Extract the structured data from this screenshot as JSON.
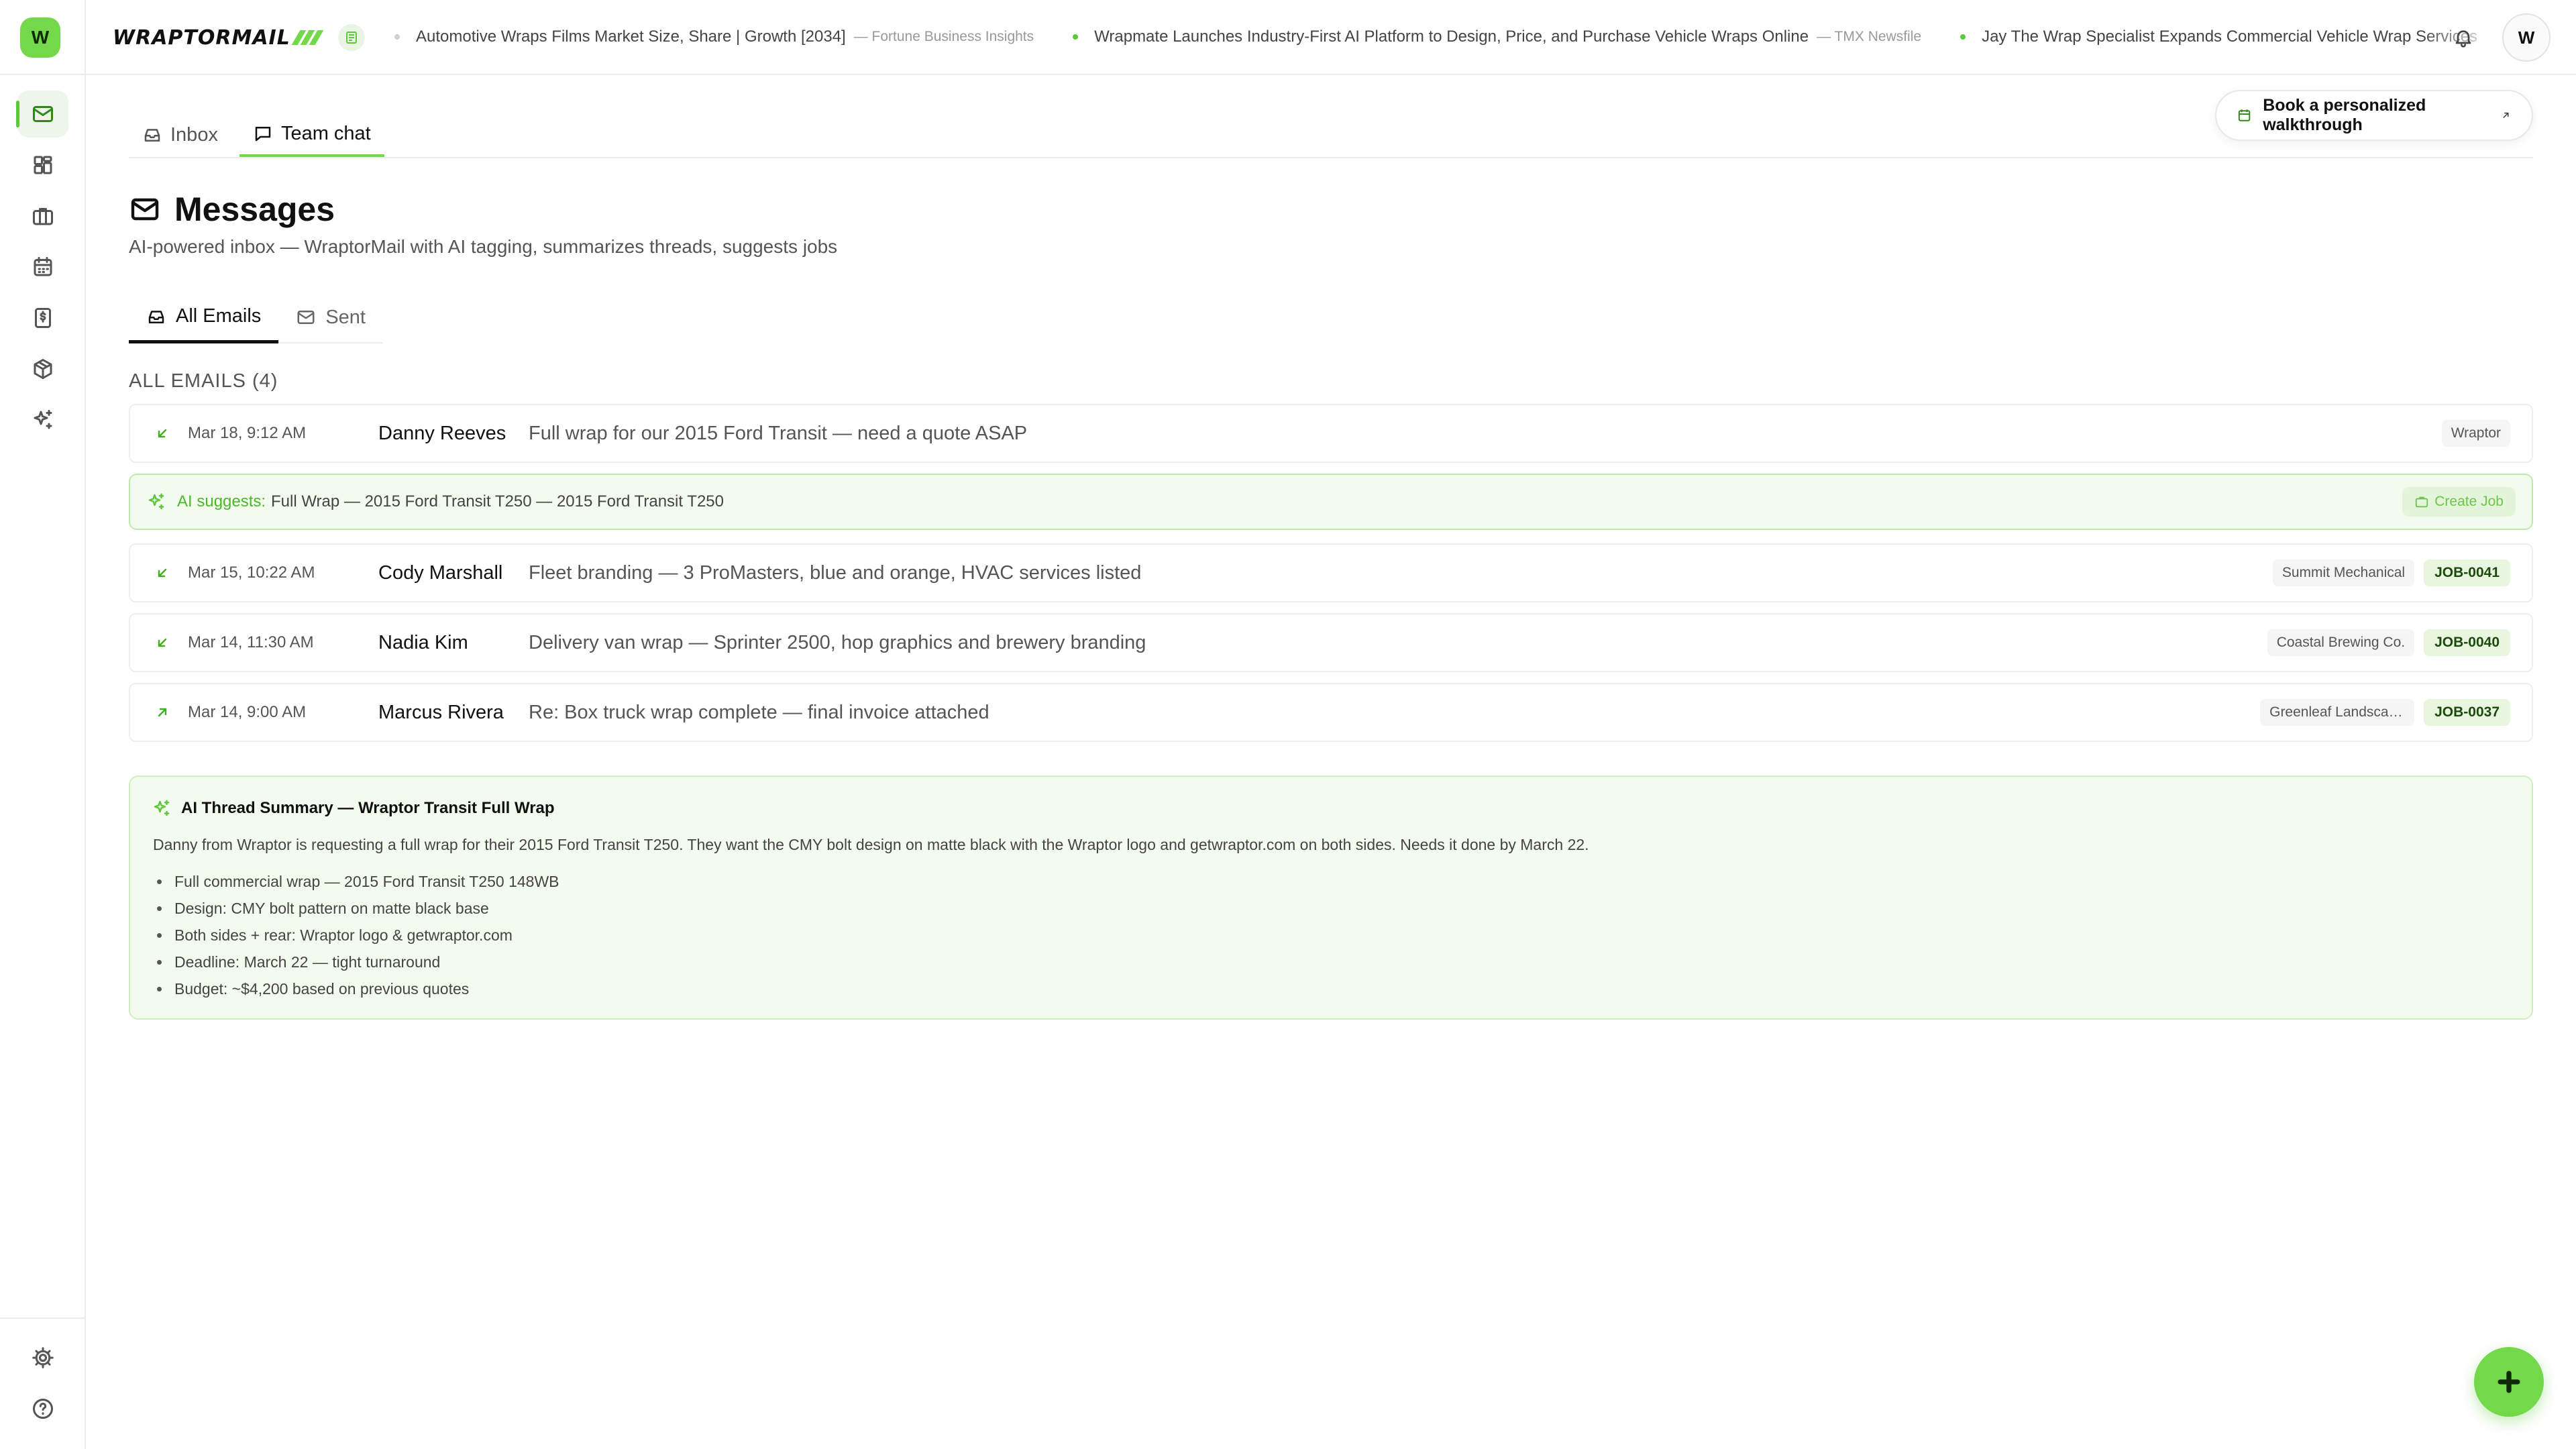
{
  "app": {
    "logo_letter": "W",
    "brand": "WRAPTORMAIL"
  },
  "colors": {
    "accent": "#74d94a",
    "accent_dark": "#2e8a14",
    "ai_bg": "#f3fbef"
  },
  "sidebar": {
    "items": [
      {
        "icon": "mail-icon",
        "active": true
      },
      {
        "icon": "dashboard-icon",
        "active": false
      },
      {
        "icon": "briefcase-icon",
        "active": false
      },
      {
        "icon": "calendar-icon",
        "active": false
      },
      {
        "icon": "invoice-icon",
        "active": false
      },
      {
        "icon": "package-icon",
        "active": false
      },
      {
        "icon": "sparkles-icon",
        "active": false
      }
    ],
    "bottom": [
      {
        "icon": "gear-icon"
      },
      {
        "icon": "help-icon"
      }
    ]
  },
  "ticker": [
    {
      "title": "Automotive Wraps Films Market Size, Share | Growth [2034]",
      "source": "— Fortune Business Insights"
    },
    {
      "title": "Wrapmate Launches Industry-First AI Platform to Design, Price, and Purchase Vehicle Wraps Online",
      "source": "— TMX Newsfile"
    },
    {
      "title": "Jay The Wrap Specialist Expands Commercial Vehicle Wrap Services",
      "source": ""
    }
  ],
  "user": {
    "initial": "W"
  },
  "top_tabs": [
    {
      "label": "Inbox",
      "active": false
    },
    {
      "label": "Team chat",
      "active": true
    }
  ],
  "walkthrough_label": "Book a personalized walkthrough",
  "page": {
    "title": "Messages",
    "subtitle": "AI-powered inbox — WraptorMail with AI tagging, summarizes threads, suggests jobs"
  },
  "sub_tabs": [
    {
      "label": "All Emails",
      "active": true
    },
    {
      "label": "Sent",
      "active": false
    }
  ],
  "section_label": "ALL EMAILS (4)",
  "emails": [
    {
      "direction": "incoming",
      "time": "Mar 18, 9:12 AM",
      "from": "Danny Reeves",
      "subject": "Full wrap for our 2015 Ford Transit — need a quote ASAP",
      "client": "Wraptor",
      "job": ""
    },
    {
      "direction": "incoming",
      "time": "Mar 15, 10:22 AM",
      "from": "Cody Marshall",
      "subject": "Fleet branding — 3 ProMasters, blue and orange, HVAC services listed",
      "client": "Summit Mechanical",
      "job": "JOB-0041"
    },
    {
      "direction": "incoming",
      "time": "Mar 14, 11:30 AM",
      "from": "Nadia Kim",
      "subject": "Delivery van wrap — Sprinter 2500, hop graphics and brewery branding",
      "client": "Coastal Brewing Co.",
      "job": "JOB-0040"
    },
    {
      "direction": "outgoing",
      "time": "Mar 14, 9:00 AM",
      "from": "Marcus Rivera",
      "subject": "Re: Box truck wrap complete — final invoice attached",
      "client": "Greenleaf Landscaping",
      "job": "JOB-0037"
    }
  ],
  "ai_suggest": {
    "label": "AI suggests:",
    "text": "Full Wrap — 2015 Ford Transit T250 — 2015 Ford Transit T250",
    "button": "Create Job"
  },
  "summary": {
    "title": "AI Thread Summary — Wraptor Transit Full Wrap",
    "paragraph": "Danny from Wraptor is requesting a full wrap for their 2015 Ford Transit T250. They want the CMY bolt design on matte black with the Wraptor logo and getwraptor.com on both sides. Needs it done by March 22.",
    "bullets": [
      "Full commercial wrap — 2015 Ford Transit T250 148WB",
      "Design: CMY bolt pattern on matte black base",
      "Both sides + rear: Wraptor logo & getwraptor.com",
      "Deadline: March 22 — tight turnaround",
      "Budget: ~$4,200 based on previous quotes"
    ]
  }
}
